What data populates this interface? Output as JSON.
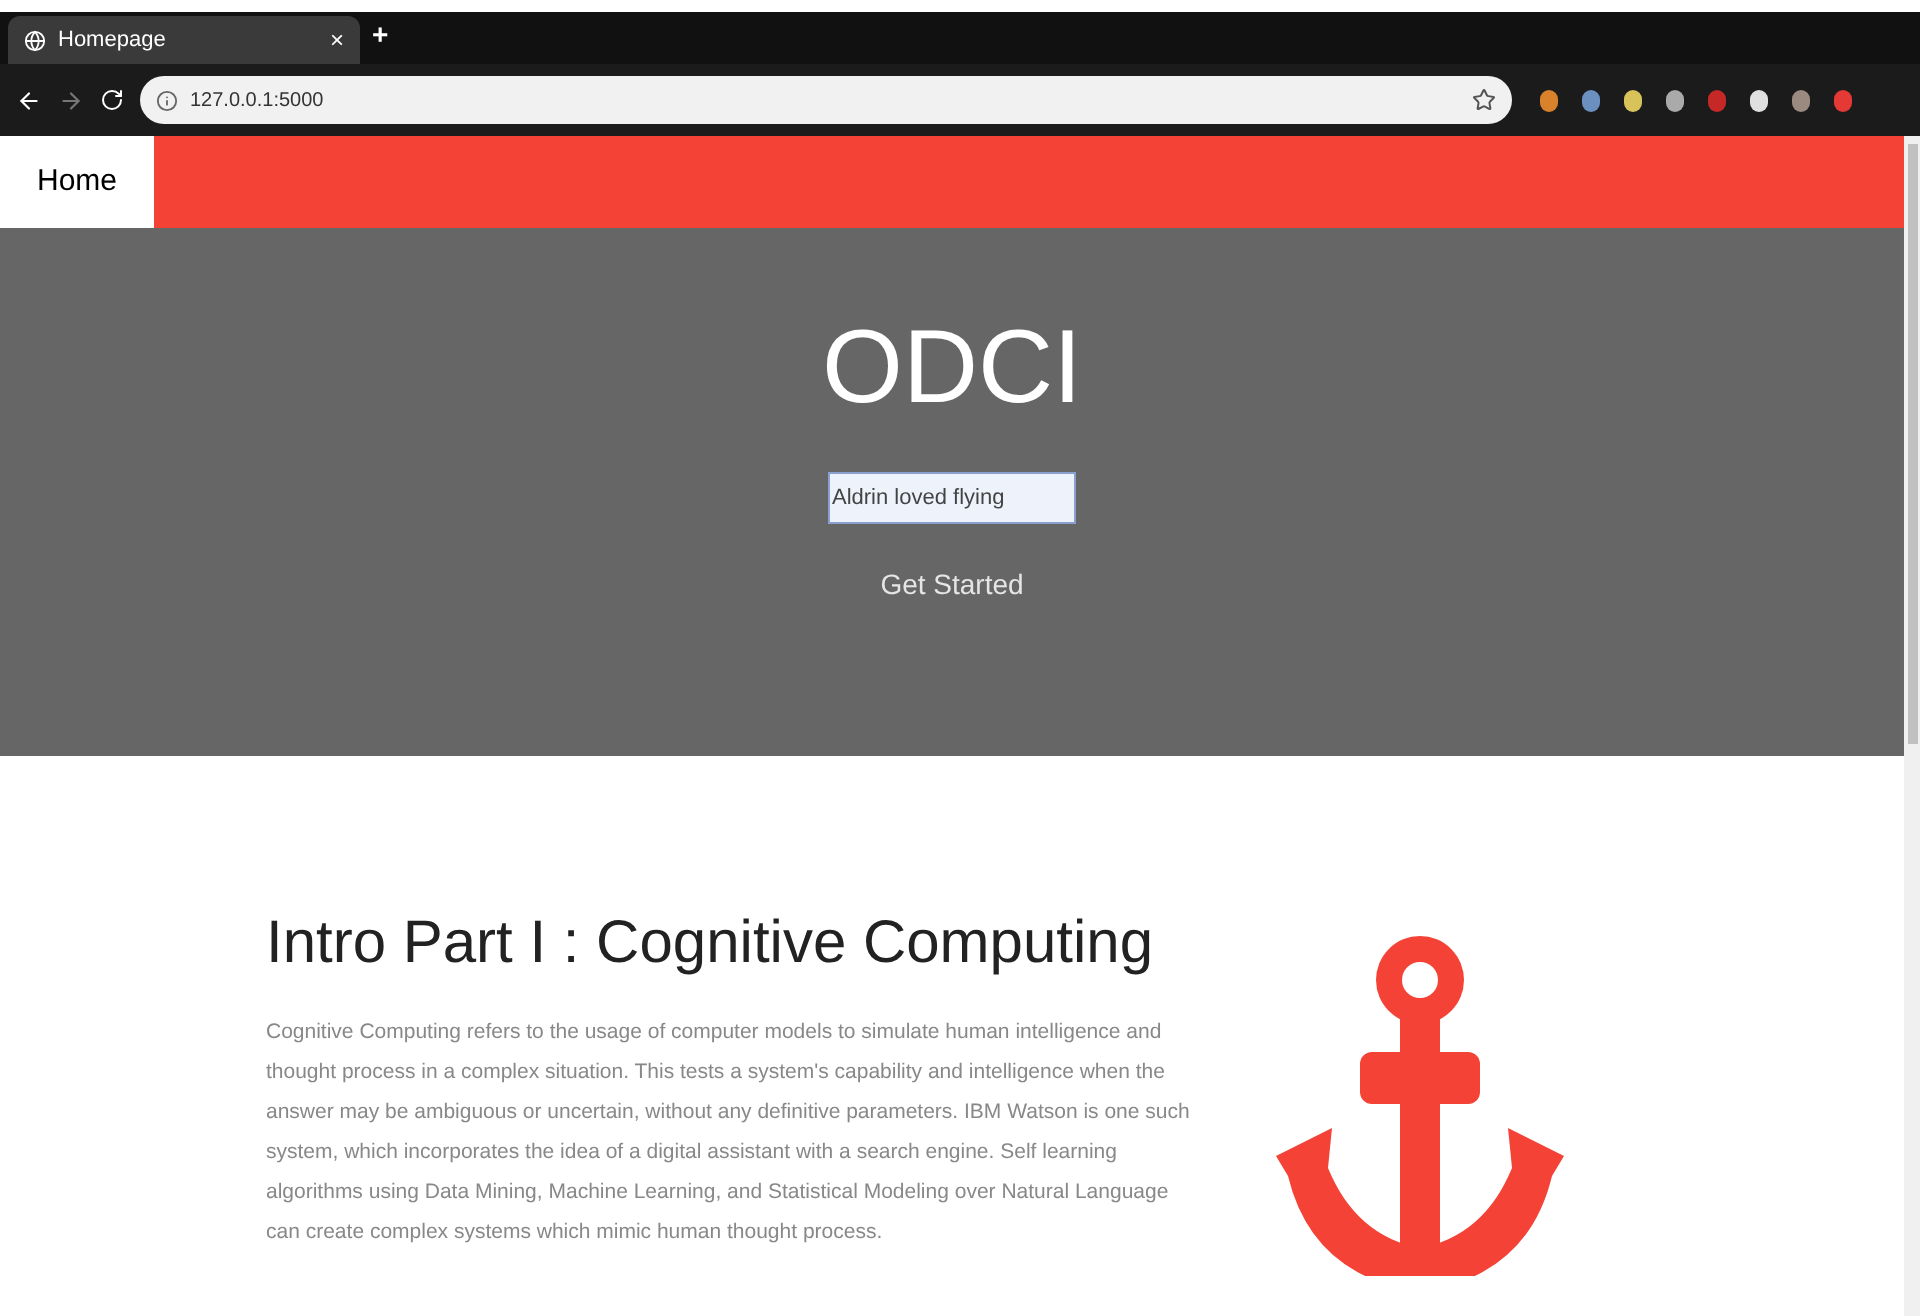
{
  "browser": {
    "tab": {
      "title": "Homepage",
      "close": "×"
    },
    "new_tab": "+",
    "url": "127.0.0.1:5000"
  },
  "nav": {
    "items": [
      {
        "label": "Home",
        "selected": true
      }
    ]
  },
  "hero": {
    "title": "ODCI",
    "input_value": "Aldrin loved flying",
    "button": "Get Started"
  },
  "intro": {
    "heading": "Intro Part I : Cognitive Computing",
    "body": "Cognitive Computing refers to the usage of computer models to simulate human intelligence and thought process in a complex situation. This tests a system's capability and intelligence when the answer may be ambiguous or uncertain, without any definitive parameters. IBM Watson is one such system, which incorporates the idea of a digital assistant with a search engine. Self learning algorithms using Data Mining, Machine Learning, and Statistical Modeling over Natural Language can create complex systems which mimic human thought process."
  }
}
